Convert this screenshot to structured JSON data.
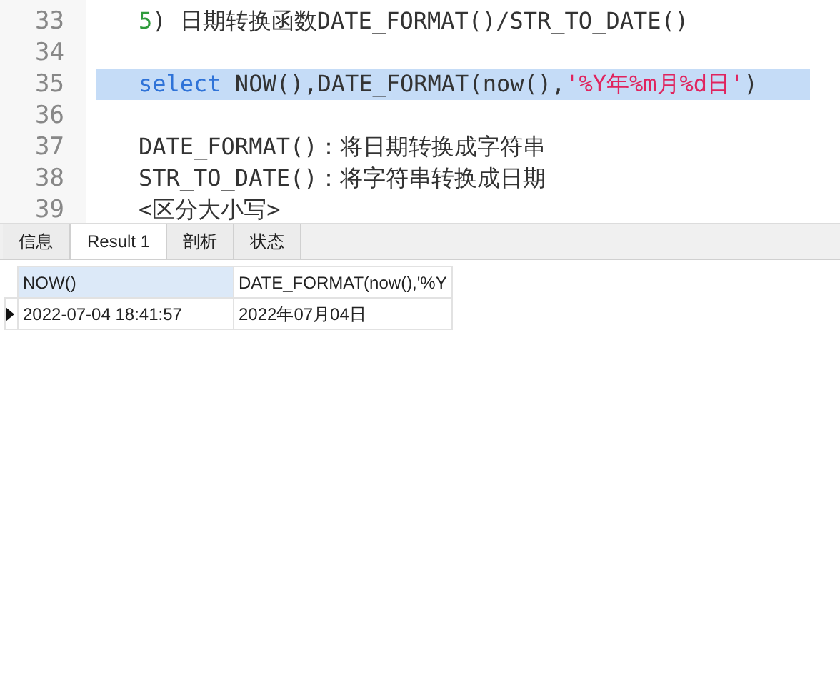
{
  "editor": {
    "lines": [
      {
        "number": "33",
        "selected": false,
        "tokens": [
          {
            "kind": "number",
            "text": "5"
          },
          {
            "kind": "plain",
            "text": ") 日期转换函数DATE_FORMAT()/STR_TO_DATE()"
          }
        ]
      },
      {
        "number": "34",
        "selected": false
      },
      {
        "number": "35",
        "selected": true,
        "tokens": [
          {
            "kind": "keyword",
            "text": "select"
          },
          {
            "kind": "plain",
            "text": " NOW(),DATE_FORMAT(now(),"
          },
          {
            "kind": "string",
            "text": "'%Y年%m月%d日'"
          },
          {
            "kind": "plain",
            "text": ")"
          }
        ]
      },
      {
        "number": "36",
        "selected": false
      },
      {
        "number": "37",
        "selected": false,
        "tokens": [
          {
            "kind": "plain",
            "text": "DATE_FORMAT()：将日期转换成字符串"
          }
        ]
      },
      {
        "number": "38",
        "selected": false,
        "tokens": [
          {
            "kind": "plain",
            "text": "STR_TO_DATE()：将字符串转换成日期"
          }
        ]
      },
      {
        "number": "39",
        "selected": false,
        "tokens": [
          {
            "kind": "plain",
            "text": "<区分大小写>"
          }
        ]
      }
    ]
  },
  "tabs": [
    {
      "label": "信息",
      "selected": false
    },
    {
      "label": "Result 1",
      "selected": true
    },
    {
      "label": "剖析",
      "selected": false
    },
    {
      "label": "状态",
      "selected": false
    }
  ],
  "table": {
    "columns": [
      {
        "label": "NOW()",
        "selected": true
      },
      {
        "label": "DATE_FORMAT(now(),'%Y",
        "selected": false
      }
    ],
    "rows": [
      {
        "current": true,
        "cells": [
          "2022-07-04 18:41:57",
          "2022年07月04日"
        ]
      }
    ]
  }
}
